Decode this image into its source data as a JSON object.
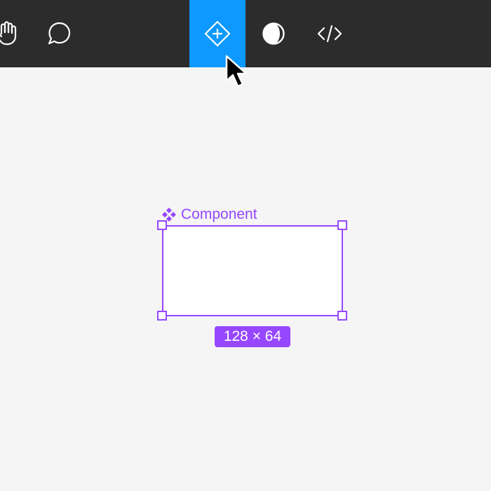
{
  "toolbar": {
    "active_tool": "component",
    "tools": [
      {
        "id": "hand",
        "icon": "hand-icon"
      },
      {
        "id": "comment",
        "icon": "comment-icon"
      },
      {
        "id": "component",
        "icon": "component-icon"
      },
      {
        "id": "theme",
        "icon": "contrast-icon"
      },
      {
        "id": "code",
        "icon": "code-icon"
      }
    ]
  },
  "canvas": {
    "frame": {
      "label": "Component",
      "label_icon": "component-diamonds-icon",
      "size_label": "128 × 64"
    }
  },
  "colors": {
    "toolbar_bg": "#2c2c2c",
    "active_tool_bg": "#0d99ff",
    "canvas_bg": "#f5f5f5",
    "selection": "#9747ff",
    "frame_fill": "#ffffff"
  },
  "cursor": {
    "icon": "arrow-cursor-icon"
  }
}
